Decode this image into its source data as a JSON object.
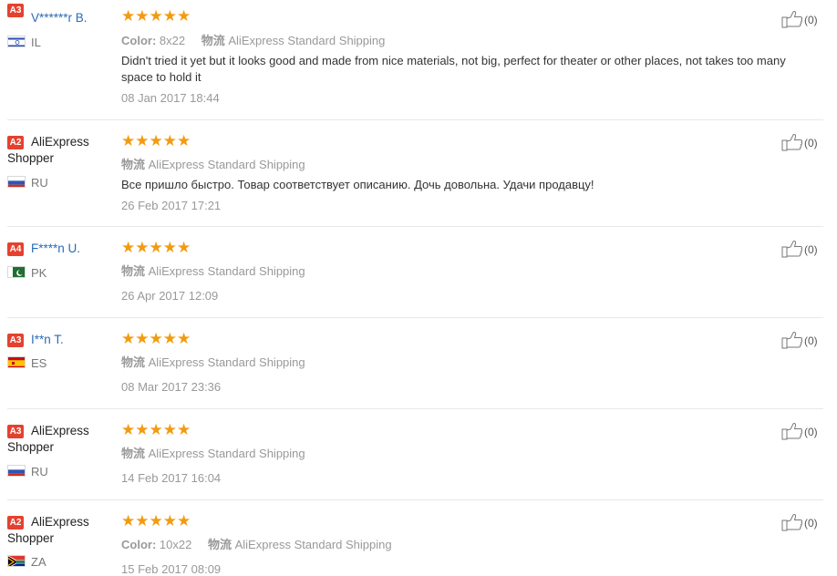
{
  "reviews": [
    {
      "badge": "A3",
      "name": "V******r B.",
      "name_line2": "",
      "name_is_link": true,
      "country": "IL",
      "flag": "il",
      "stars": "★★★★★",
      "color_label": "Color:",
      "color_value": "8x22",
      "shipping_label": "物流",
      "shipping_value": "AliExpress Standard Shipping",
      "text": "Didn't tried it yet but it looks good and made from nice materials, not big, perfect for theater or other places, not takes too many space to hold it",
      "date": "08 Jan 2017 18:44",
      "likes": "(0)"
    },
    {
      "badge": "A2",
      "name": "AliExpress",
      "name_line2": "Shopper",
      "name_is_link": false,
      "country": "RU",
      "flag": "ru",
      "stars": "★★★★★",
      "color_label": "",
      "color_value": "",
      "shipping_label": "物流",
      "shipping_value": "AliExpress Standard Shipping",
      "text": "Все пришло быстро. Товар соответствует описанию. Дочь довольна. Удачи продавцу!",
      "date": "26 Feb 2017 17:21",
      "likes": "(0)"
    },
    {
      "badge": "A4",
      "name": "F****n U.",
      "name_line2": "",
      "name_is_link": true,
      "country": "PK",
      "flag": "pk",
      "stars": "★★★★★",
      "color_label": "",
      "color_value": "",
      "shipping_label": "物流",
      "shipping_value": "AliExpress Standard Shipping",
      "text": "",
      "date": "26 Apr 2017 12:09",
      "likes": "(0)"
    },
    {
      "badge": "A3",
      "name": "I**n T.",
      "name_line2": "",
      "name_is_link": true,
      "country": "ES",
      "flag": "es",
      "stars": "★★★★★",
      "color_label": "",
      "color_value": "",
      "shipping_label": "物流",
      "shipping_value": "AliExpress Standard Shipping",
      "text": "",
      "date": "08 Mar 2017 23:36",
      "likes": "(0)"
    },
    {
      "badge": "A3",
      "name": "AliExpress",
      "name_line2": "Shopper",
      "name_is_link": false,
      "country": "RU",
      "flag": "ru",
      "stars": "★★★★★",
      "color_label": "",
      "color_value": "",
      "shipping_label": "物流",
      "shipping_value": "AliExpress Standard Shipping",
      "text": "",
      "date": "14 Feb 2017 16:04",
      "likes": "(0)"
    },
    {
      "badge": "A2",
      "name": "AliExpress",
      "name_line2": "Shopper",
      "name_is_link": false,
      "country": "ZA",
      "flag": "za",
      "stars": "★★★★★",
      "color_label": "Color:",
      "color_value": "10x22",
      "shipping_label": "物流",
      "shipping_value": "AliExpress Standard Shipping",
      "text": "",
      "date": "15 Feb 2017 08:09",
      "likes": "(0)"
    }
  ],
  "colors": {
    "star": "#f29b11",
    "badge": "#e5412e",
    "link": "#2a6bb6",
    "muted": "#999999",
    "divider": "#e8e8e8"
  }
}
